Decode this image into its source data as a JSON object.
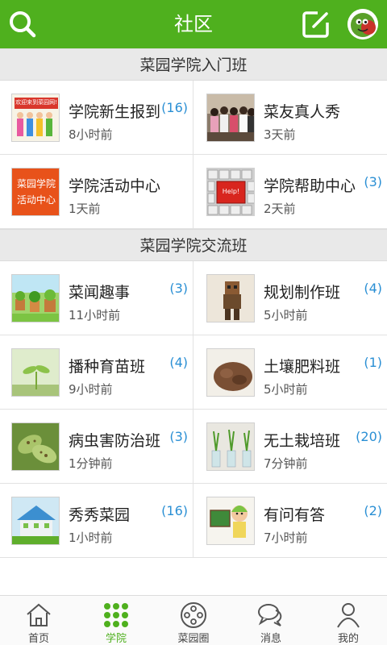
{
  "header": {
    "title": "社区",
    "search_icon": "search-icon",
    "edit_icon": "edit-icon",
    "avatar_icon": "avatar-icon",
    "brand_color": "#4fb01e"
  },
  "sections": [
    {
      "title": "菜园学院入门班",
      "items": [
        {
          "name": "学院新生报到",
          "time": "8小时前",
          "count": "(16)",
          "thumb_text": "欢迎来到菜园网!"
        },
        {
          "name": "菜友真人秀",
          "time": "3天前",
          "count": ""
        },
        {
          "name": "学院活动中心",
          "time": "1天前",
          "count": "",
          "thumb_text": "菜园学院活动中心"
        },
        {
          "name": "学院帮助中心",
          "time": "2天前",
          "count": "(3)",
          "thumb_text": "Help!"
        }
      ]
    },
    {
      "title": "菜园学院交流班",
      "items": [
        {
          "name": "菜闻趣事",
          "time": "11小时前",
          "count": "(3)"
        },
        {
          "name": "规划制作班",
          "time": "5小时前",
          "count": "(4)"
        },
        {
          "name": "播种育苗班",
          "time": "9小时前",
          "count": "(4)"
        },
        {
          "name": "土壤肥料班",
          "time": "5小时前",
          "count": "(1)"
        },
        {
          "name": "病虫害防治班",
          "time": "1分钟前",
          "count": "(3)"
        },
        {
          "name": "无土栽培班",
          "time": "7分钟前",
          "count": "(20)"
        },
        {
          "name": "秀秀菜园",
          "time": "1小时前",
          "count": "(16)"
        },
        {
          "name": "有问有答",
          "time": "7小时前",
          "count": "(2)"
        }
      ]
    }
  ],
  "bottom_nav": [
    {
      "label": "首页",
      "icon": "home-icon",
      "active": false
    },
    {
      "label": "学院",
      "icon": "dots-grid-icon",
      "active": true
    },
    {
      "label": "菜园圈",
      "icon": "circle-icon",
      "active": false
    },
    {
      "label": "消息",
      "icon": "chat-bubbles-icon",
      "active": false
    },
    {
      "label": "我的",
      "icon": "person-icon",
      "active": false
    }
  ],
  "colors": {
    "accent": "#4fb01e",
    "count": "#2a8fd4",
    "section_bg": "#e9e9e9"
  }
}
